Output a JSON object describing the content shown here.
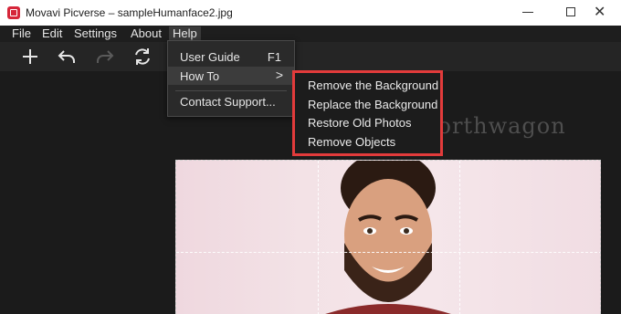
{
  "window": {
    "title": "Movavi Picverse – sampleHumanface2.jpg",
    "close_glyph": "✕"
  },
  "menubar": {
    "items": [
      "File",
      "Edit",
      "Settings",
      "About",
      "Help"
    ]
  },
  "toolbar": {
    "icons": [
      "plus-icon",
      "undo-icon",
      "redo-icon",
      "refresh-icon"
    ]
  },
  "help_menu": {
    "user_guide": "User Guide",
    "user_guide_shortcut": "F1",
    "how_to": "How To",
    "how_to_arrow": ">",
    "contact_support": "Contact Support..."
  },
  "how_to_submenu": {
    "items": [
      "Remove the Background",
      "Replace the Background",
      "Restore Old Photos",
      "Remove Objects"
    ]
  },
  "watermark": "worthwagon",
  "colors": {
    "highlight_border": "#e23b3b",
    "app_icon": "#d6263a",
    "background": "#1b1b1b"
  }
}
